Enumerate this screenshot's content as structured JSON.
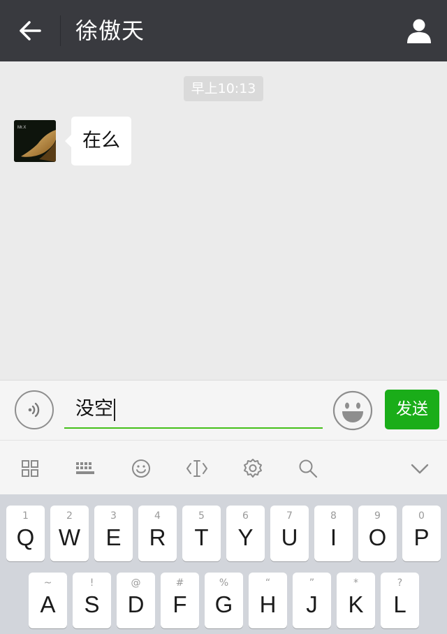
{
  "header": {
    "title": "徐傲天",
    "back_icon": "arrow-left-icon",
    "profile_icon": "person-icon"
  },
  "chat": {
    "timestamp": "早上10:13",
    "messages": [
      {
        "sender": "contact",
        "text": "在么",
        "avatar_text": "Mr.X"
      }
    ]
  },
  "input_bar": {
    "voice_icon": "voice-icon",
    "text_value": "没空",
    "emoji_icon": "smiley-icon",
    "send_label": "发送",
    "accent_color": "#1aad19"
  },
  "ime_toolbar": {
    "items": [
      "grid-icon",
      "keyboard-icon",
      "emoji-icon",
      "cursor-icon",
      "settings-icon",
      "search-icon",
      "chevron-down-icon"
    ]
  },
  "keyboard": {
    "row1": [
      {
        "main": "Q",
        "hint": "1"
      },
      {
        "main": "W",
        "hint": "2"
      },
      {
        "main": "E",
        "hint": "3"
      },
      {
        "main": "R",
        "hint": "4"
      },
      {
        "main": "T",
        "hint": "5"
      },
      {
        "main": "Y",
        "hint": "6"
      },
      {
        "main": "U",
        "hint": "7"
      },
      {
        "main": "I",
        "hint": "8"
      },
      {
        "main": "O",
        "hint": "9"
      },
      {
        "main": "P",
        "hint": "0"
      }
    ],
    "row2": [
      {
        "main": "A",
        "hint": "~"
      },
      {
        "main": "S",
        "hint": "!"
      },
      {
        "main": "D",
        "hint": "@"
      },
      {
        "main": "F",
        "hint": "#"
      },
      {
        "main": "G",
        "hint": "%"
      },
      {
        "main": "H",
        "hint": "“"
      },
      {
        "main": "J",
        "hint": "”"
      },
      {
        "main": "K",
        "hint": "*"
      },
      {
        "main": "L",
        "hint": "?"
      }
    ]
  }
}
